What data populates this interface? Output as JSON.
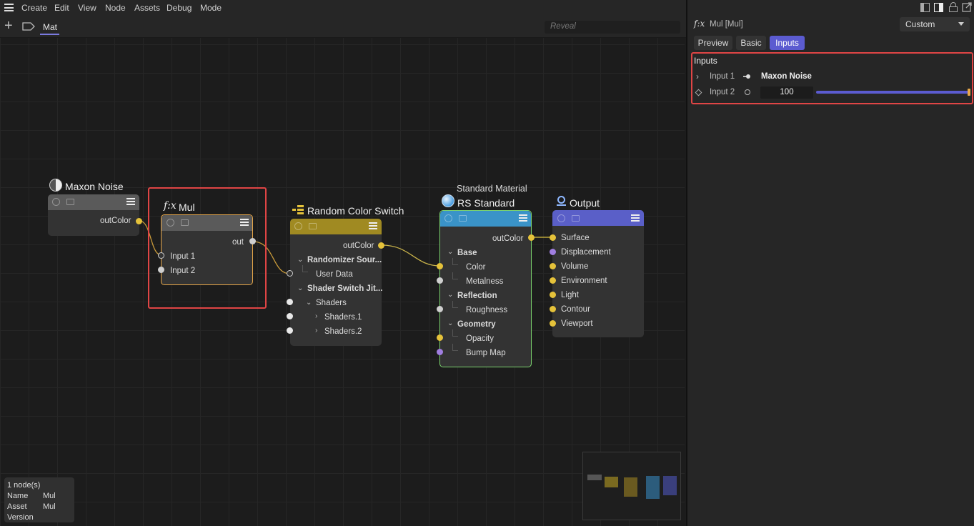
{
  "menu": [
    "Create",
    "Edit",
    "View",
    "Node",
    "Assets",
    "Debug",
    "Mode"
  ],
  "toolbar": {
    "tab_label": "Mat",
    "reveal_placeholder": "Reveal"
  },
  "nodes": {
    "noise": {
      "title": "Maxon Noise",
      "out": "outColor"
    },
    "mul": {
      "icon_text": "f:x",
      "title": "Mul",
      "out": "out",
      "in1": "Input 1",
      "in2": "Input 2"
    },
    "rcs": {
      "title": "Random Color Switch",
      "out": "outColor",
      "g1": "Randomizer Sour...",
      "g1_item": "User Data",
      "g2": "Shader Switch Jit...",
      "g2_item": "Shaders",
      "s1": "Shaders.1",
      "s2": "Shaders.2"
    },
    "rs": {
      "super": "Standard Material",
      "title": "RS Standard",
      "out": "outColor",
      "base": "Base",
      "color": "Color",
      "metal": "Metalness",
      "refl": "Reflection",
      "rough": "Roughness",
      "geo": "Geometry",
      "opacity": "Opacity",
      "bump": "Bump Map"
    },
    "output": {
      "title": "Output",
      "items": [
        "Surface",
        "Displacement",
        "Volume",
        "Environment",
        "Light",
        "Contour",
        "Viewport"
      ]
    }
  },
  "info": {
    "count": "1 node(s)",
    "name_label": "Name",
    "name_value": "Mul",
    "asset_label": "Asset",
    "asset_value": "Mul",
    "version_label": "Version"
  },
  "panel": {
    "icon_text": "f:x",
    "title": "Mul [Mul]",
    "layout_select": "Custom",
    "tabs": [
      "Preview",
      "Basic",
      "Inputs"
    ],
    "active_tab": "Inputs",
    "section": "Inputs",
    "input1_label": "Input 1",
    "input1_value": "Maxon Noise",
    "input2_label": "Input 2",
    "input2_value": "100",
    "slider_fraction": 1.0
  },
  "colors": {
    "accent": "#5b5bd0",
    "highlight": "#e04545",
    "yellow_port": "#e5c23a",
    "purple_port": "#a07ee0",
    "mul_border": "#e8a84a",
    "rs_border": "#7bd36d"
  }
}
